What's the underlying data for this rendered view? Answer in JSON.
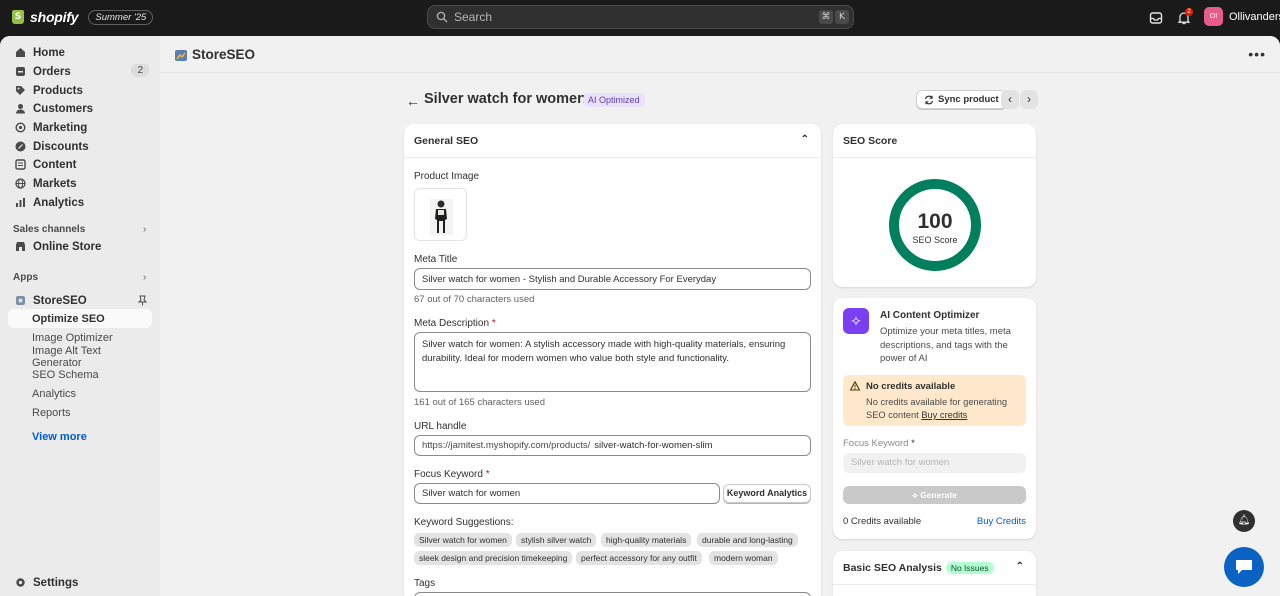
{
  "topbar": {
    "brand": "shopify",
    "edition": "Summer '25",
    "search_placeholder": "Search",
    "shortcut_keys": [
      "⌘",
      "K"
    ],
    "notification_count": "2",
    "store_initials": "OI",
    "store_name": "Ollivanders"
  },
  "sidebar": {
    "items": [
      {
        "label": "Home",
        "icon": "home-icon"
      },
      {
        "label": "Orders",
        "icon": "orders-icon",
        "count": "2"
      },
      {
        "label": "Products",
        "icon": "tag-icon"
      },
      {
        "label": "Customers",
        "icon": "person-icon"
      },
      {
        "label": "Marketing",
        "icon": "target-icon"
      },
      {
        "label": "Discounts",
        "icon": "discount-icon"
      },
      {
        "label": "Content",
        "icon": "content-icon"
      },
      {
        "label": "Markets",
        "icon": "globe-icon"
      },
      {
        "label": "Analytics",
        "icon": "chart-bars-icon"
      }
    ],
    "sales_channels_label": "Sales channels",
    "online_store": "Online Store",
    "apps_label": "Apps",
    "app_name": "StoreSEO",
    "app_subitems": [
      "Optimize SEO",
      "Image Optimizer",
      "Image Alt Text Generator",
      "SEO Schema",
      "Analytics",
      "Reports"
    ],
    "view_more": "View more",
    "settings": "Settings"
  },
  "app_header": {
    "title": "StoreSEO"
  },
  "page": {
    "title": "Silver watch for women",
    "badge": "AI Optimized",
    "sync_button": "Sync product",
    "prev": "‹",
    "next": "›"
  },
  "general_seo": {
    "heading": "General SEO",
    "product_image_label": "Product Image",
    "meta_title_label": "Meta Title",
    "meta_title_value": "Silver watch for women - Stylish and Durable Accessory For Everyday",
    "meta_title_help": "67 out of 70 characters used",
    "meta_description_label": "Meta Description",
    "meta_description_value": "Silver watch for women: A stylish accessory made with high-quality materials, ensuring durability. Ideal for modern women who value both style and functionality.",
    "meta_description_help": "161 out of 165 characters used",
    "url_label": "URL handle",
    "url_prefix": "https://jamitest.myshopify.com/products/",
    "url_handle": "silver-watch-for-women-slim",
    "focus_keyword_label": "Focus Keyword",
    "focus_keyword_value": "Silver watch for women",
    "keyword_analytics_button": "Keyword Analytics",
    "suggestions_label": "Keyword Suggestions:",
    "suggestions": [
      "Silver watch for women",
      "stylish silver watch",
      "high-quality materials",
      "durable and long-lasting",
      "sleek design and precision timekeeping",
      "perfect accessory for any outfit",
      "modern woman"
    ],
    "tags_label": "Tags"
  },
  "seo_score": {
    "heading": "SEO Score",
    "value": "100",
    "caption": "SEO Score",
    "score_fraction": 1.0,
    "ring_color": "#007f5f"
  },
  "ai_optimizer": {
    "title": "AI Content Optimizer",
    "description_lines": [
      "Optimize your meta titles, meta",
      "descriptions, and tags with the",
      "power of AI"
    ],
    "warning_title": "No credits available",
    "warning_line1": "No credits available for generating",
    "warning_line2": "SEO content",
    "warning_link": "Buy credits",
    "focus_keyword_label": "Focus Keyword",
    "focus_keyword_placeholder": "Silver watch for women",
    "generate_button": "Generate",
    "credits_text": "0 Credits available",
    "buy_credits": "Buy Credits"
  },
  "basic_analysis": {
    "heading": "Basic SEO Analysis",
    "badge": "No Issues"
  }
}
